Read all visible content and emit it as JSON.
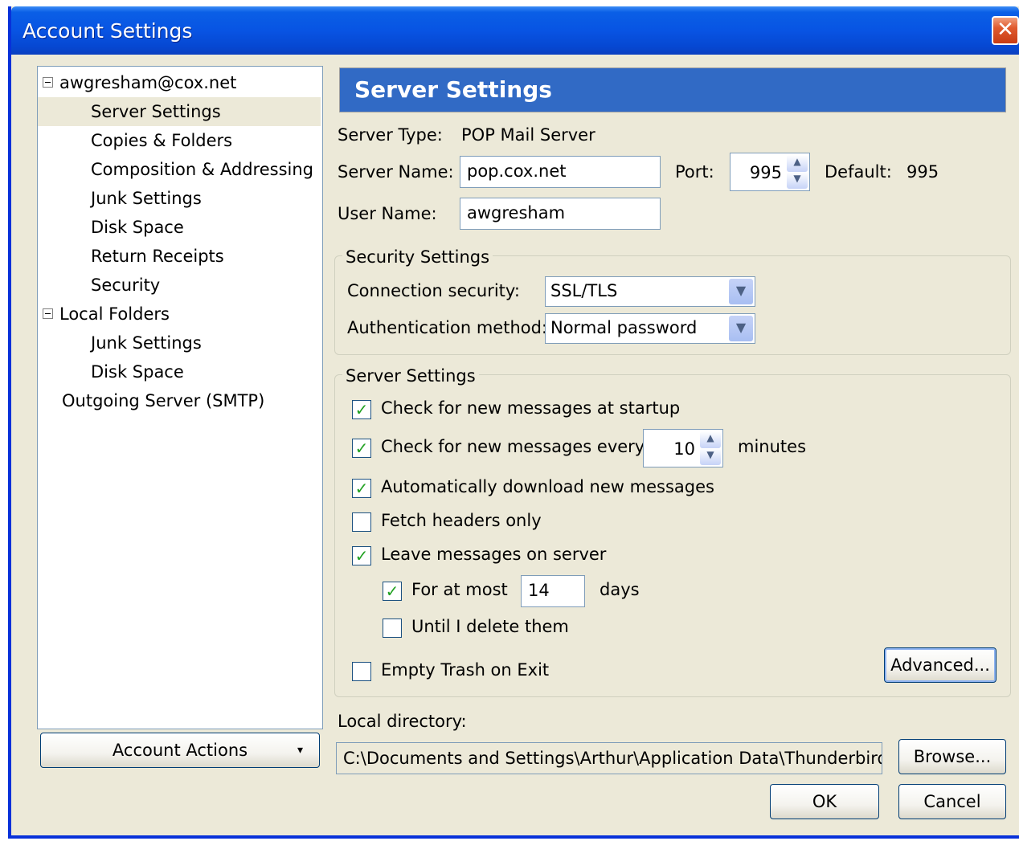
{
  "window": {
    "title": "Account Settings",
    "close_glyph": "✕"
  },
  "tree": {
    "items": [
      {
        "label": "awgresham@cox.net",
        "level": 0,
        "expanded": true
      },
      {
        "label": "Server Settings",
        "level": 1,
        "selected": true
      },
      {
        "label": "Copies & Folders",
        "level": 1
      },
      {
        "label": "Composition & Addressing",
        "level": 1
      },
      {
        "label": "Junk Settings",
        "level": 1
      },
      {
        "label": "Disk Space",
        "level": 1
      },
      {
        "label": "Return Receipts",
        "level": 1
      },
      {
        "label": "Security",
        "level": 1
      },
      {
        "label": "Local Folders",
        "level": 0,
        "expanded": true
      },
      {
        "label": "Junk Settings",
        "level": 1
      },
      {
        "label": "Disk Space",
        "level": 1
      },
      {
        "label": "Outgoing Server (SMTP)",
        "level": 0
      }
    ],
    "account_actions": "Account Actions",
    "account_actions_arrow": "▾"
  },
  "panel": {
    "header": "Server Settings",
    "server_type_label": "Server Type:",
    "server_type_value": "POP Mail Server",
    "server_name_label": "Server Name:",
    "server_name_value": "pop.cox.net",
    "port_label": "Port:",
    "port_value": "995",
    "default_label": "Default:",
    "default_value": "995",
    "user_name_label": "User Name:",
    "user_name_value": "awgresham"
  },
  "security": {
    "caption": "Security Settings",
    "connection_label": "Connection security:",
    "connection_value": "SSL/TLS",
    "auth_label": "Authentication method:",
    "auth_value": "Normal password"
  },
  "server_settings": {
    "caption": "Server Settings",
    "check_startup": {
      "label": "Check for new messages at startup",
      "checked": true
    },
    "check_every": {
      "label": "Check for new messages every",
      "checked": true,
      "value": "10",
      "unit": "minutes"
    },
    "auto_download": {
      "label": "Automatically download new messages",
      "checked": true
    },
    "fetch_headers": {
      "label": "Fetch headers only",
      "checked": false
    },
    "leave_on_server": {
      "label": "Leave messages on server",
      "checked": true
    },
    "for_at_most": {
      "label": "For at most",
      "checked": true,
      "value": "14",
      "unit": "days"
    },
    "until_delete": {
      "label": "Until I delete them",
      "checked": false
    },
    "empty_trash": {
      "label": "Empty Trash on Exit",
      "checked": false
    },
    "advanced_button": "Advanced..."
  },
  "local_directory": {
    "label": "Local directory:",
    "path": "C:\\Documents and Settings\\Arthur\\Application Data\\Thunderbird\\Profiles",
    "browse_button": "Browse..."
  },
  "buttons": {
    "ok": "OK",
    "cancel": "Cancel"
  },
  "glyphs": {
    "check": "✓",
    "spin_up": "▲",
    "spin_down": "▼",
    "dropdown": "▼"
  }
}
